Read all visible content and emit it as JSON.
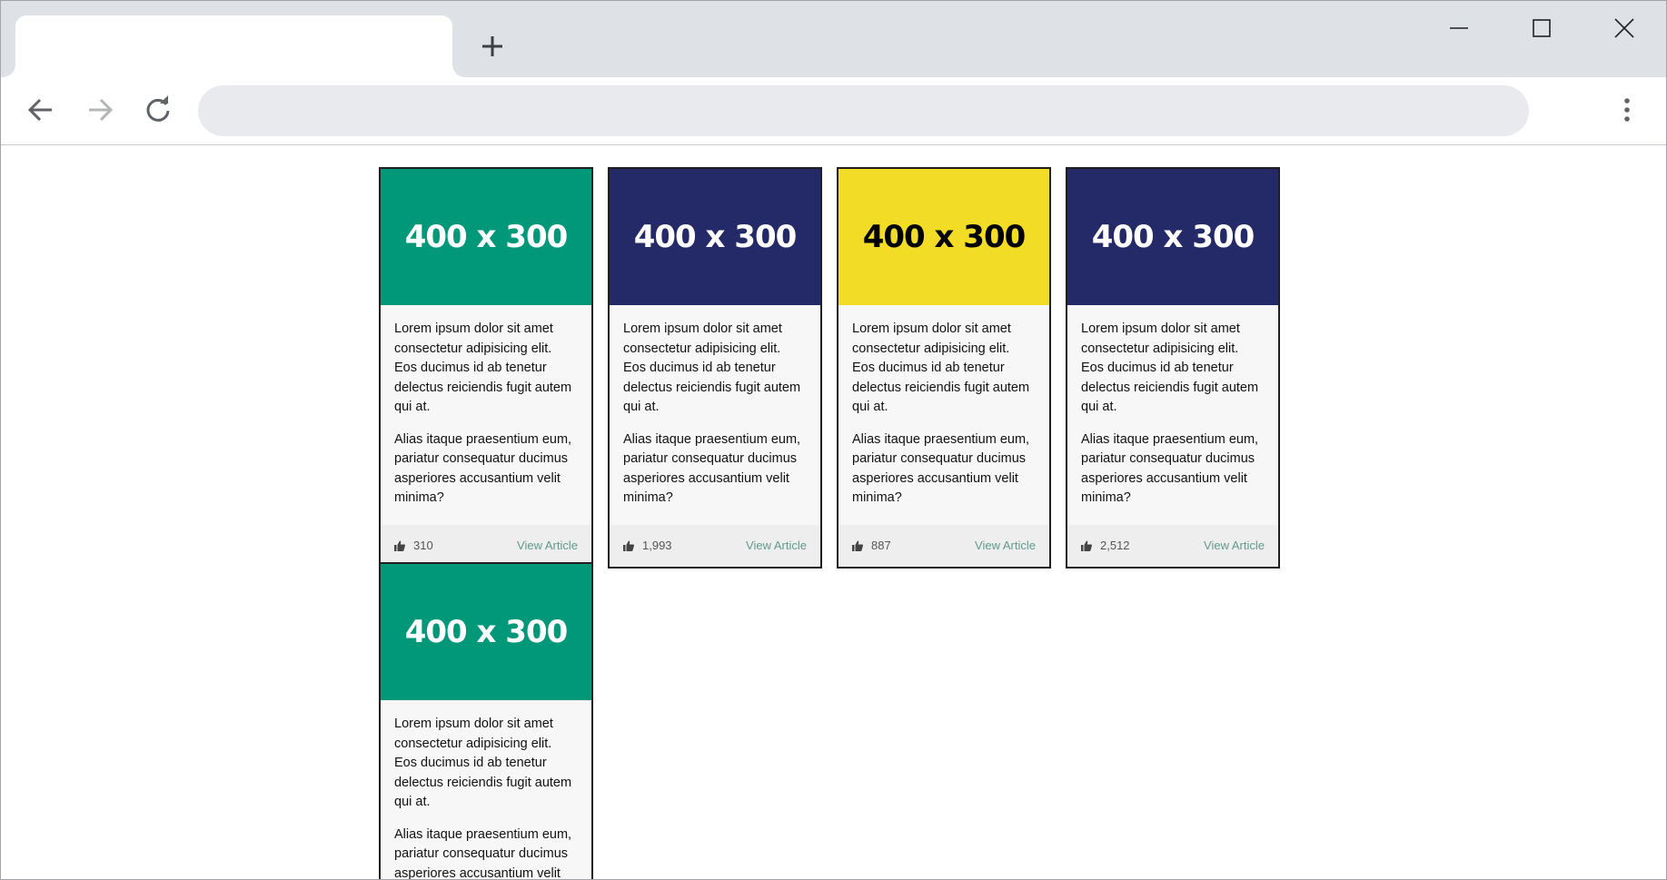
{
  "browser": {
    "tab_title": "",
    "address": ""
  },
  "cards": [
    {
      "image_label": "400 x 300",
      "image_bg": "#009879",
      "image_fg": "#ffffff",
      "paragraphs": [
        "Lorem ipsum dolor sit amet consectetur adipisicing elit. Eos ducimus id ab tenetur delectus reiciendis fugit autem qui at.",
        "Alias itaque praesentium eum, pariatur consequatur ducimus asperiores accusantium velit minima?"
      ],
      "likes": "310",
      "link_label": "View Article"
    },
    {
      "image_label": "400 x 300",
      "image_bg": "#242a68",
      "image_fg": "#ffffff",
      "paragraphs": [
        "Lorem ipsum dolor sit amet consectetur adipisicing elit. Eos ducimus id ab tenetur delectus reiciendis fugit autem qui at.",
        "Alias itaque praesentium eum, pariatur consequatur ducimus asperiores accusantium velit minima?"
      ],
      "likes": "1,993",
      "link_label": "View Article"
    },
    {
      "image_label": "400 x 300",
      "image_bg": "#f2dc26",
      "image_fg": "#000000",
      "paragraphs": [
        "Lorem ipsum dolor sit amet consectetur adipisicing elit. Eos ducimus id ab tenetur delectus reiciendis fugit autem qui at.",
        "Alias itaque praesentium eum, pariatur consequatur ducimus asperiores accusantium velit minima?"
      ],
      "likes": "887",
      "link_label": "View Article"
    },
    {
      "image_label": "400 x 300",
      "image_bg": "#242a68",
      "image_fg": "#ffffff",
      "paragraphs": [
        "Lorem ipsum dolor sit amet consectetur adipisicing elit. Eos ducimus id ab tenetur delectus reiciendis fugit autem qui at.",
        "Alias itaque praesentium eum, pariatur consequatur ducimus asperiores accusantium velit minima?"
      ],
      "likes": "2,512",
      "link_label": "View Article"
    },
    {
      "image_label": "400 x 300",
      "image_bg": "#009879",
      "image_fg": "#ffffff",
      "paragraphs": [
        "Lorem ipsum dolor sit amet consectetur adipisicing elit. Eos ducimus id ab tenetur delectus reiciendis fugit autem qui at.",
        "Alias itaque praesentium eum, pariatur consequatur ducimus asperiores accusantium velit minima?"
      ],
      "likes": "",
      "link_label": ""
    }
  ],
  "icons": {
    "new_tab": "plus-icon",
    "minimize": "minimize-icon",
    "maximize": "maximize-icon",
    "close": "close-icon",
    "back": "back-arrow-icon",
    "forward": "forward-arrow-icon",
    "reload": "reload-icon",
    "menu": "kebab-menu-icon",
    "like": "thumbs-up-icon"
  }
}
